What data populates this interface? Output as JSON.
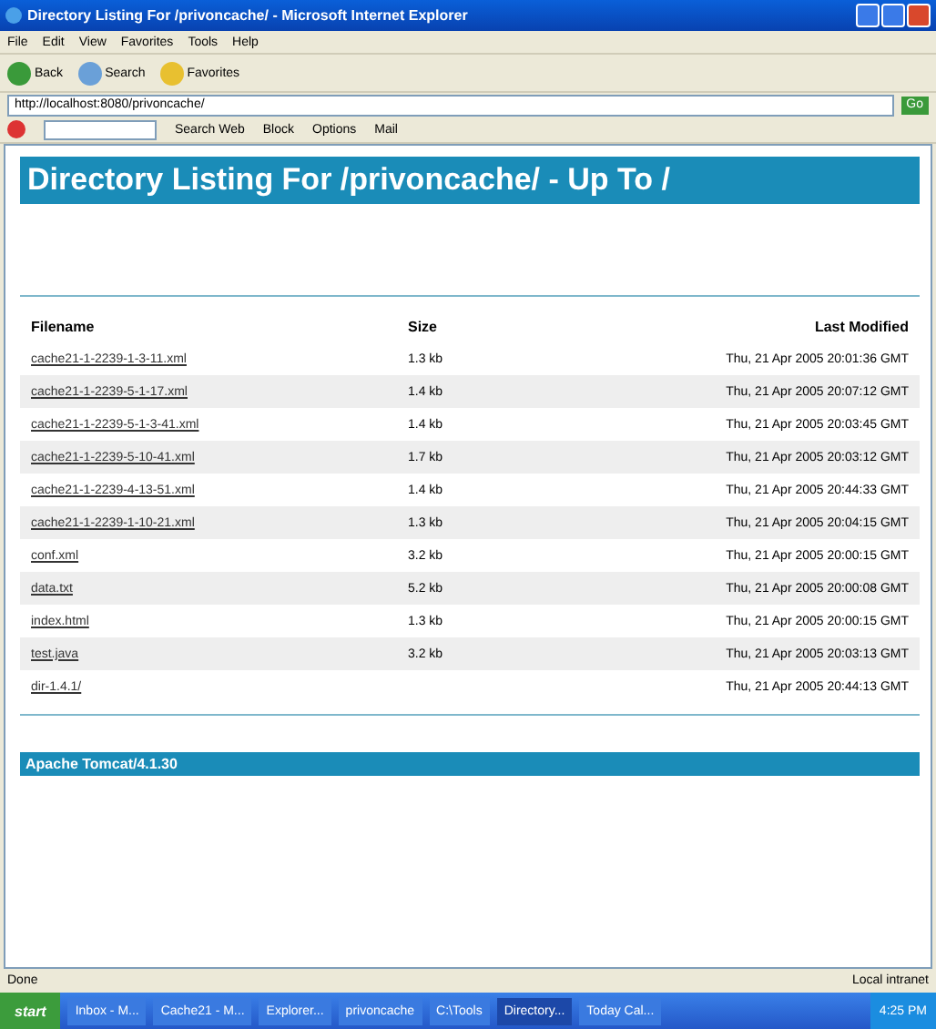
{
  "window": {
    "title": "Directory Listing For /privoncache/ - Microsoft Internet Explorer"
  },
  "menu": [
    "File",
    "Edit",
    "View",
    "Favorites",
    "Tools",
    "Help"
  ],
  "toolbar": [
    {
      "kind": "back",
      "label": "Back"
    },
    {
      "kind": "search",
      "label": "Search"
    },
    {
      "kind": "favorites",
      "label": "Favorites"
    }
  ],
  "address": {
    "value": "http://localhost:8080/privoncache/",
    "go": "Go"
  },
  "links_bar": [
    "Search Web",
    "Block",
    "Options",
    "Mail"
  ],
  "page": {
    "heading": "Directory Listing For /privoncache/ - Up To /",
    "columns": [
      "Filename",
      "Size",
      "Last Modified"
    ],
    "rows": [
      {
        "name": "cache21-1-2239-1-3-11.xml",
        "size": "1.3 kb",
        "modified": "Thu, 21 Apr 2005 20:01:36 GMT"
      },
      {
        "name": "cache21-1-2239-5-1-17.xml",
        "size": "1.4 kb",
        "modified": "Thu, 21 Apr 2005 20:07:12 GMT"
      },
      {
        "name": "cache21-1-2239-5-1-3-41.xml",
        "size": "1.4 kb",
        "modified": "Thu, 21 Apr 2005 20:03:45 GMT"
      },
      {
        "name": "cache21-1-2239-5-10-41.xml",
        "size": "1.7 kb",
        "modified": "Thu, 21 Apr 2005 20:03:12 GMT"
      },
      {
        "name": "cache21-1-2239-4-13-51.xml",
        "size": "1.4 kb",
        "modified": "Thu, 21 Apr 2005 20:44:33 GMT"
      },
      {
        "name": "cache21-1-2239-1-10-21.xml",
        "size": "1.3 kb",
        "modified": "Thu, 21 Apr 2005 20:04:15 GMT"
      },
      {
        "name": "conf.xml",
        "size": "3.2 kb",
        "modified": "Thu, 21 Apr 2005 20:00:15 GMT"
      },
      {
        "name": "data.txt",
        "size": "5.2 kb",
        "modified": "Thu, 21 Apr 2005 20:00:08 GMT"
      },
      {
        "name": "index.html",
        "size": "1.3 kb",
        "modified": "Thu, 21 Apr 2005 20:00:15 GMT"
      },
      {
        "name": "test.java",
        "size": "3.2 kb",
        "modified": "Thu, 21 Apr 2005 20:03:13 GMT"
      },
      {
        "name": "dir-1.4.1/",
        "size": "",
        "modified": "Thu, 21 Apr 2005 20:44:13 GMT"
      }
    ],
    "footer": "Apache Tomcat/4.1.30"
  },
  "status_bar": {
    "text": "Done",
    "zone": "Local intranet"
  },
  "taskbar": {
    "start": "start",
    "items": [
      {
        "label": "Inbox - M...",
        "selected": false
      },
      {
        "label": "Cache21 - M...",
        "selected": false
      },
      {
        "label": "Explorer...",
        "selected": false
      },
      {
        "label": "privoncache",
        "selected": false
      },
      {
        "label": "C:\\Tools",
        "selected": false
      },
      {
        "label": "Directory...",
        "selected": true
      },
      {
        "label": "Today Cal...",
        "selected": false
      }
    ],
    "clock": "4:25 PM"
  }
}
